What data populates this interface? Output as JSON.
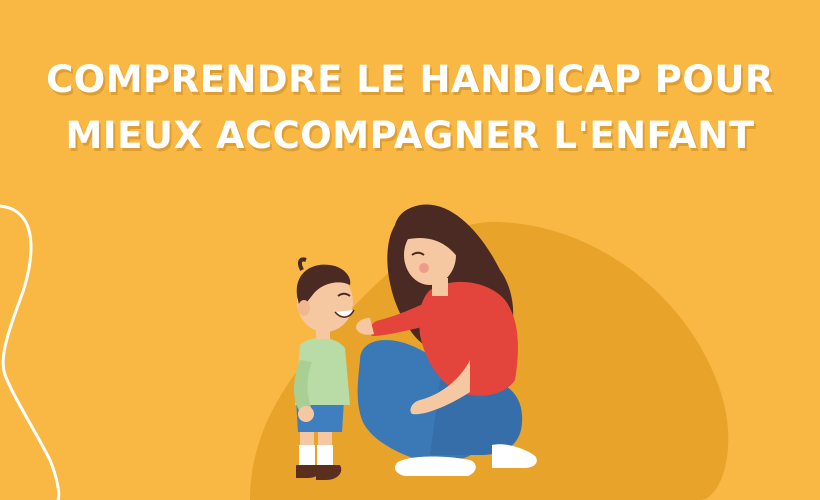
{
  "title": {
    "line1": "COMPRENDRE LE HANDICAP POUR",
    "line2": "MIEUX ACCOMPAGNER L'ENFANT"
  },
  "colors": {
    "background": "#f9b843",
    "blob": "#e8a32a",
    "title_text": "#ffffff",
    "mother_shirt": "#e3443c",
    "jeans": "#3b79b6",
    "hair": "#4a2a22",
    "child_shirt": "#b9dca6",
    "child_shorts": "#3f7fc0",
    "skin": "#f6c8a2"
  }
}
